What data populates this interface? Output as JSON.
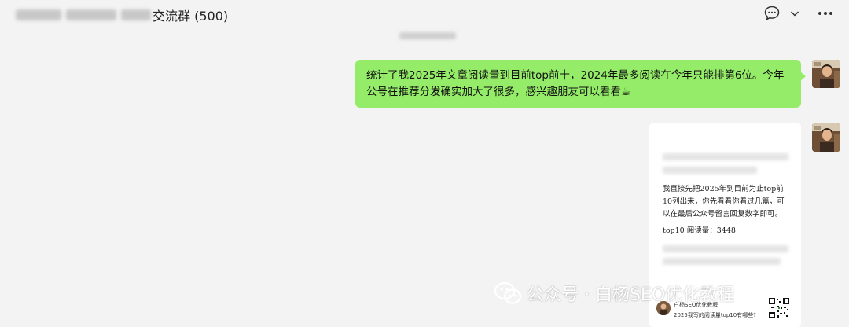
{
  "header": {
    "title": "交流群 (500)"
  },
  "messages": {
    "sent_text": "统计了我2025年文章阅读量到目前top前十，2024年最多阅读在今年只能排第6位。今年公号在推荐分发确实加大了很多，感兴趣朋友可以看看☕"
  },
  "card": {
    "paragraph": "我直接先把2025年到目前为止top前10列出来，你先看看你看过几篇，可以在最后公众号留言回复数字即可。",
    "stat": "top10 阅读量：3448",
    "footer_name": "白杨SEO优化教程",
    "footer_desc": "2025我写的阅读量top10有哪些?"
  },
  "watermark": {
    "text": "公众号 · 白杨SEO优化教程"
  },
  "icons": {
    "chat": "chat-bubble-icon",
    "chevron": "chevron-down-icon",
    "more": "more-dots-icon",
    "wechat": "wechat-logo-icon",
    "qr": "qr-code-icon"
  },
  "colors": {
    "sent_bubble": "#95ec69",
    "background": "#f3f3f3"
  }
}
